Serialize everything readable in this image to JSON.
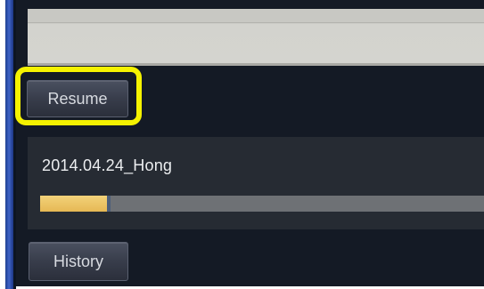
{
  "toolbar": {
    "resume_label": "Resume"
  },
  "job": {
    "name": "2014.04.24_Hong",
    "progress": 0.15
  },
  "footer": {
    "history_label": "History"
  },
  "colors": {
    "highlight": "#f5f200",
    "progress": "#e6b854",
    "background": "#141a25"
  }
}
